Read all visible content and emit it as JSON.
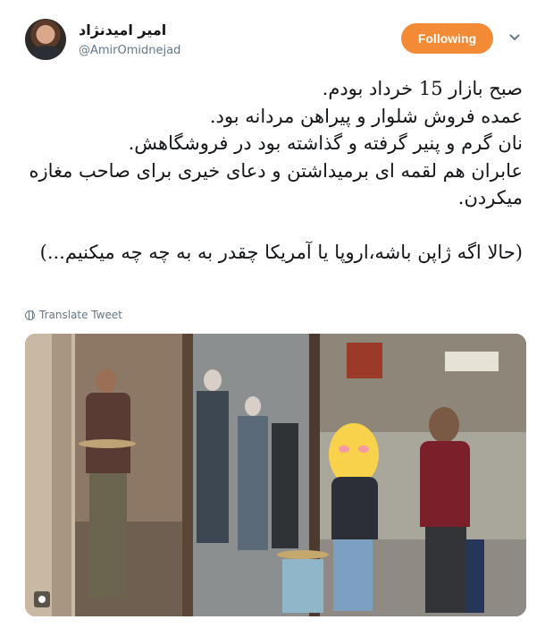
{
  "header": {
    "display_name": "امیر امیدنژاد",
    "handle": "@AmirOmidnejad",
    "follow_label": "Following",
    "follow_color": "#f38a35",
    "menu_icon": "chevron-down-icon"
  },
  "tweet": {
    "lines": [
      "صبح بازار 15 خرداد بودم.",
      "عمده فروش شلوار و پیراهن مردانه بود.",
      "نان گرم و پنیر گرفته و گذاشته بود در فروشگاهش.",
      "عابران هم لقمه ای برمیداشتن و دعای خیری برای صاحب مغازه میکردن.",
      "(حالا اگه ژاپن باشه،اروپا یا آمریکا چقدر به به چه چه میکنیم...)"
    ]
  },
  "translate": {
    "label": "Translate Tweet",
    "icon": "globe-icon"
  },
  "media": {
    "description_icon": "image-icon"
  }
}
